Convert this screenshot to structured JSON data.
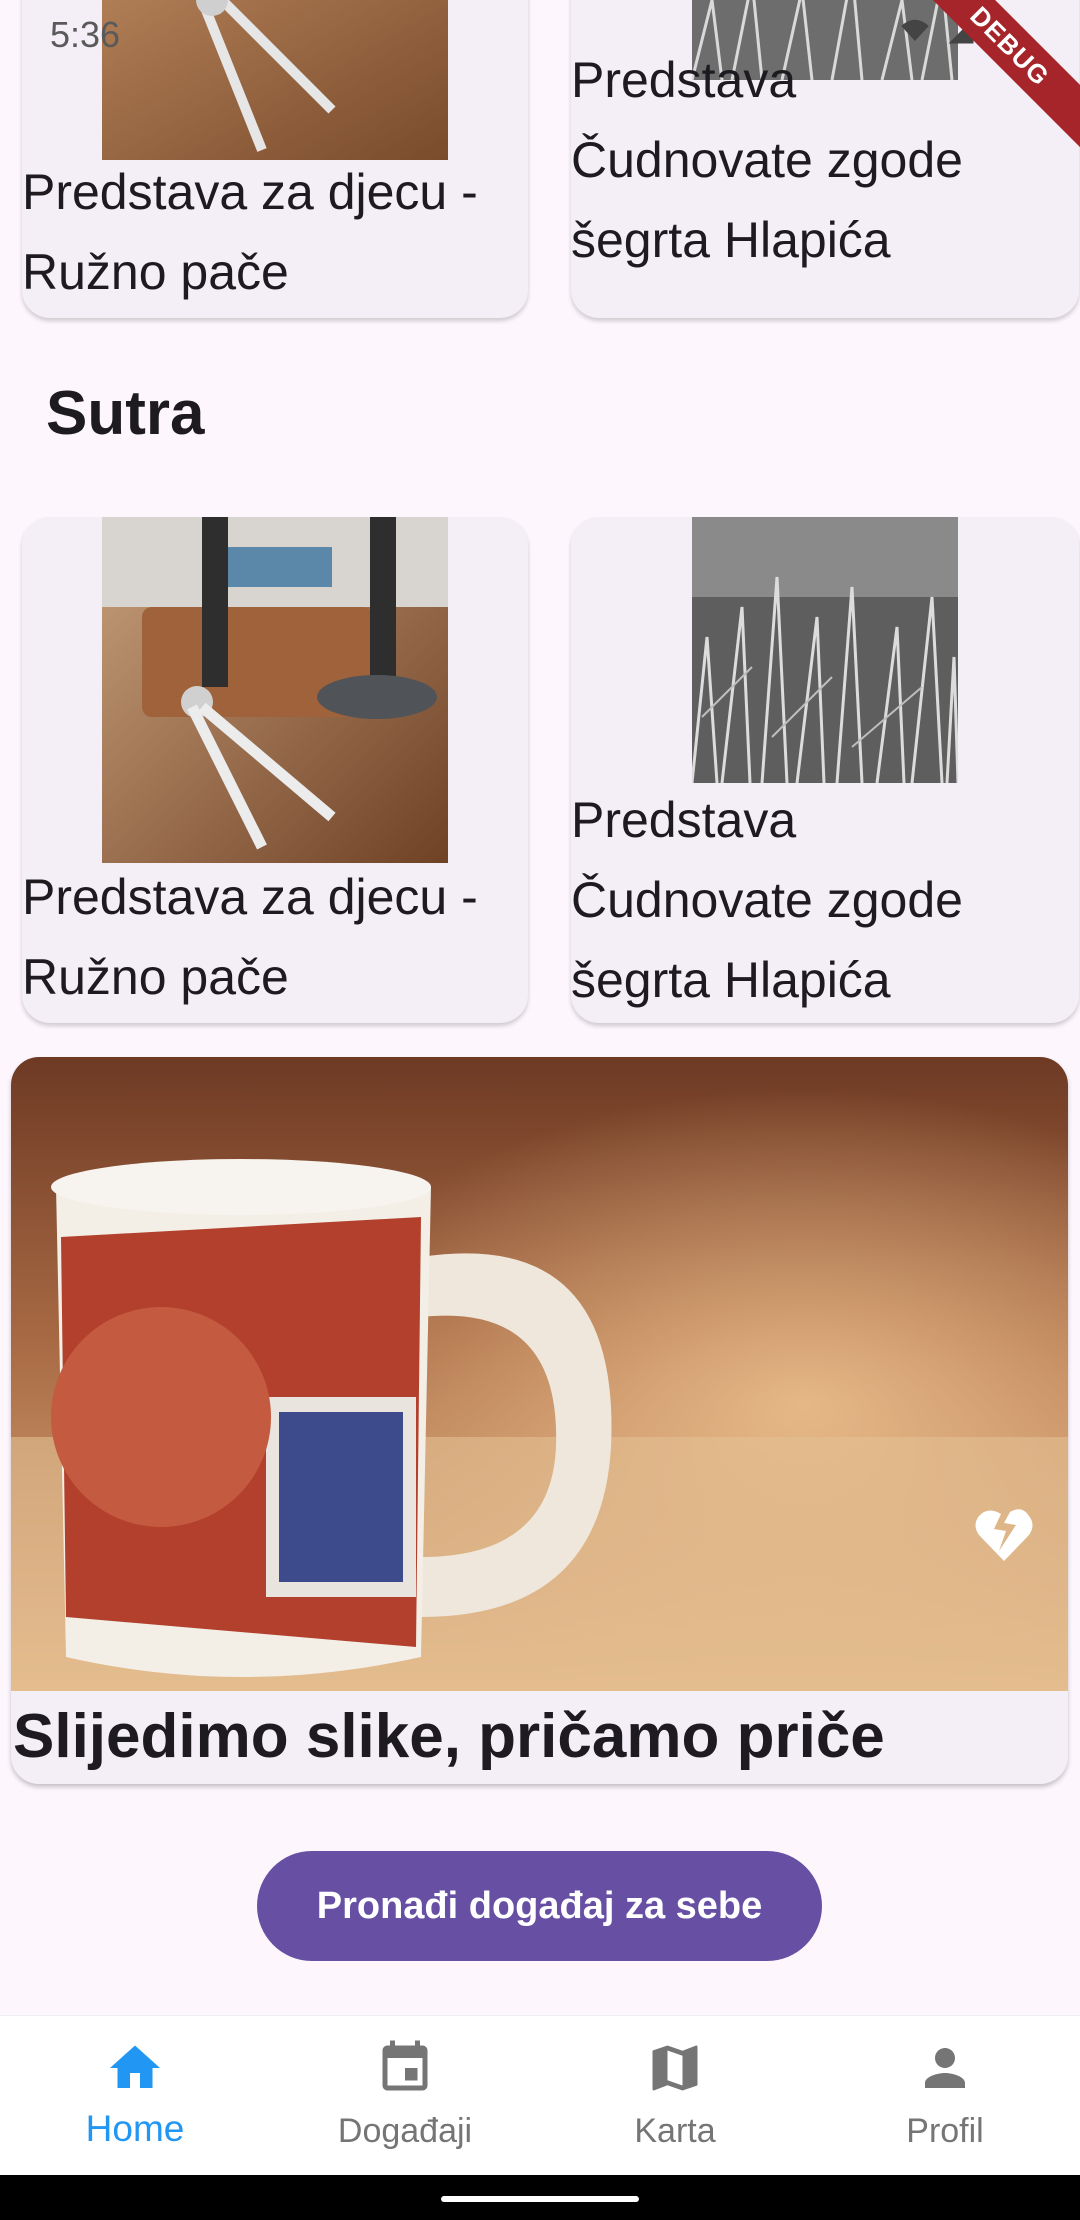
{
  "status_bar": {
    "time": "5:36"
  },
  "debug_banner": "DEBUG",
  "top_row": [
    {
      "title": "Predstava za djecu - Ružno pače",
      "image": "compass-on-desk-photo"
    },
    {
      "title": "Predstava Čudnovate zgode šegrta Hlapića",
      "image": "grass-grayscale-photo"
    }
  ],
  "section": {
    "title": "Sutra"
  },
  "tomorrow_row": [
    {
      "title": "Predstava za djecu - Ružno pače",
      "image": "compass-on-desk-photo"
    },
    {
      "title": "Predstava Čudnovate zgode šegrta Hlapića",
      "image": "grass-grayscale-photo"
    }
  ],
  "feature": {
    "title": "Slijedimo slike, pričamo priče",
    "image": "cuba-stamp-mug-photo",
    "favorite_icon": "broken-heart-icon"
  },
  "cta": {
    "label": "Pronađi događaj za sebe"
  },
  "nav": {
    "active": "Home",
    "items": [
      {
        "label": "Home",
        "icon": "home-icon"
      },
      {
        "label": "Događaji",
        "icon": "calendar-icon"
      },
      {
        "label": "Karta",
        "icon": "map-icon"
      },
      {
        "label": "Profil",
        "icon": "person-icon"
      }
    ]
  },
  "colors": {
    "background": "#fdf7fd",
    "card": "#f4eff6",
    "primary_button": "#6750a4",
    "nav_active": "#2196f3",
    "nav_inactive": "#757575",
    "debug_banner": "#a5252a"
  }
}
